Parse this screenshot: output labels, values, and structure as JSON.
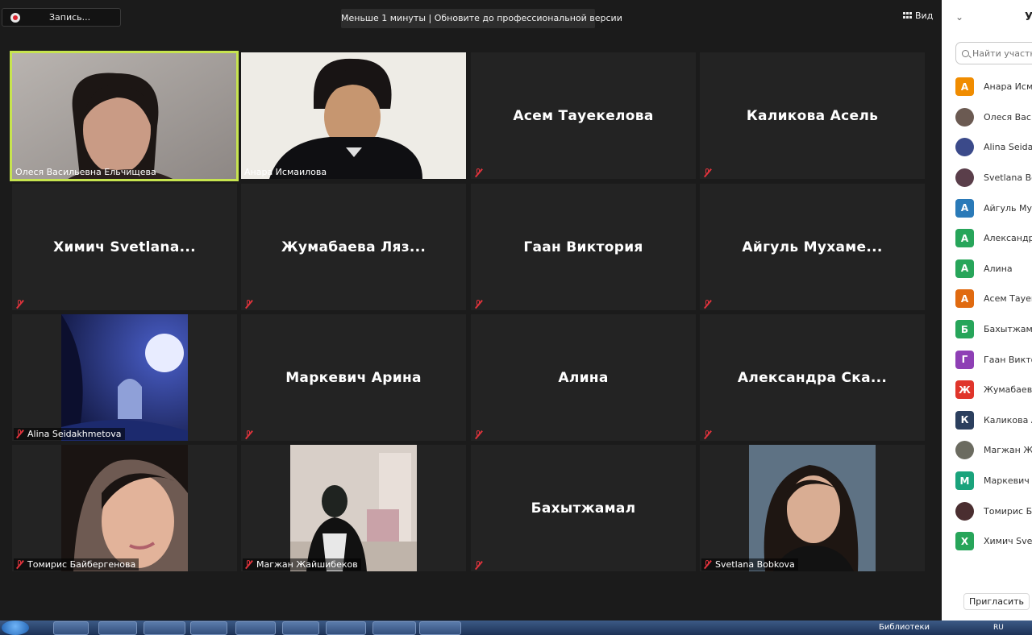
{
  "top_bar": {
    "recording_label": "Запись...",
    "upgrade_banner": "Меньше 1 минуты | Обновите до профессиональной версии",
    "view_label": "Вид"
  },
  "tiles": [
    {
      "type": "video",
      "name": "Олеся Васильевна Ельчищева",
      "muted": false,
      "active": true
    },
    {
      "type": "video",
      "name": "Анара Исмаилова",
      "muted": false,
      "active": false
    },
    {
      "type": "name",
      "name": "Асем Тауекелова",
      "muted": true
    },
    {
      "type": "name",
      "name": "Каликова Асель",
      "muted": true
    },
    {
      "type": "name",
      "name": "Химич Svetlana...",
      "muted": true
    },
    {
      "type": "name",
      "name": "Жумабаева Ляз...",
      "muted": true
    },
    {
      "type": "name",
      "name": "Гаан Виктория",
      "muted": true
    },
    {
      "type": "name",
      "name": "Айгуль Мухаме...",
      "muted": true
    },
    {
      "type": "picture",
      "name": "Alina Seidakhmetova",
      "muted": true
    },
    {
      "type": "name",
      "name": "Маркевич Арина",
      "muted": true
    },
    {
      "type": "name",
      "name": "Алина",
      "muted": true
    },
    {
      "type": "name",
      "name": "Александра Ска...",
      "muted": true
    },
    {
      "type": "picture",
      "name": "Томирис Байбергенова",
      "muted": true
    },
    {
      "type": "picture",
      "name": "Магжан Жайшибеков",
      "muted": true
    },
    {
      "type": "name",
      "name": "Бахытжамал",
      "muted": true
    },
    {
      "type": "picture",
      "name": "Svetlana Bobkova",
      "muted": true
    }
  ],
  "panel": {
    "title": "У",
    "search_placeholder": "Найти участн",
    "participants": [
      {
        "initial": "А",
        "name": "Анара Исм",
        "color": "#f08c00"
      },
      {
        "initial": "",
        "name": "Олеся Васи",
        "color": "#6b5a52"
      },
      {
        "initial": "",
        "name": "Alina Seida",
        "color": "#3b4a8a"
      },
      {
        "initial": "",
        "name": "Svetlana Bo",
        "color": "#5a3e4a"
      },
      {
        "initial": "А",
        "name": "Айгуль Мух",
        "color": "#2a7ab8"
      },
      {
        "initial": "А",
        "name": "Александра",
        "color": "#27a55a"
      },
      {
        "initial": "А",
        "name": "Алина",
        "color": "#27a55a"
      },
      {
        "initial": "А",
        "name": "Асем Тауек",
        "color": "#e06a10"
      },
      {
        "initial": "Б",
        "name": "Бахытжама",
        "color": "#27a55a"
      },
      {
        "initial": "Г",
        "name": "Гаан Викто",
        "color": "#8e3fb5"
      },
      {
        "initial": "Ж",
        "name": "Жумабаева",
        "color": "#e0352b"
      },
      {
        "initial": "К",
        "name": "Каликова А",
        "color": "#2b3f5e"
      },
      {
        "initial": "",
        "name": "Магжан Жа",
        "color": "#6b6b60"
      },
      {
        "initial": "М",
        "name": "Маркевич",
        "color": "#1aa37c"
      },
      {
        "initial": "",
        "name": "Томирис Ба",
        "color": "#4a2e30"
      },
      {
        "initial": "Х",
        "name": "Химич Svet",
        "color": "#27a55a"
      }
    ],
    "invite_label": "Пригласить"
  },
  "taskbar": {
    "folder_label": "Библиотеки",
    "lang": "RU"
  }
}
